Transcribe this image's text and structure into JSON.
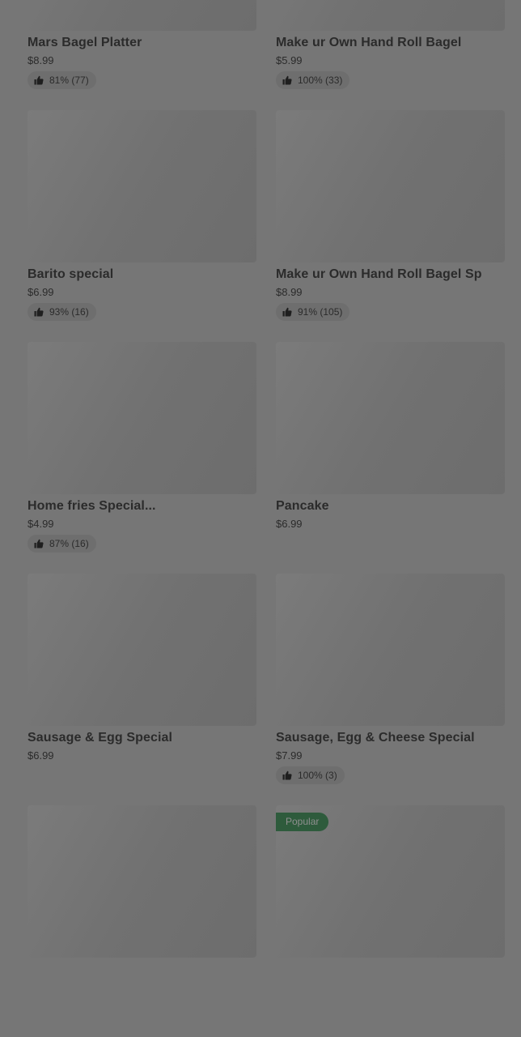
{
  "menu": {
    "items": [
      {
        "name": "Mars Bagel Platter",
        "price": "$8.99",
        "rating": "81% (77)",
        "badge": null
      },
      {
        "name": "Make ur Own Hand Roll Bagel",
        "price": "$5.99",
        "rating": "100% (33)",
        "badge": null
      },
      {
        "name": "Barito special",
        "price": "$6.99",
        "rating": "93% (16)",
        "badge": null
      },
      {
        "name": "Make ur Own Hand Roll Bagel Sp",
        "price": "$8.99",
        "rating": "91% (105)",
        "badge": null
      },
      {
        "name": "Home fries Special...",
        "price": "$4.99",
        "rating": "87% (16)",
        "badge": null
      },
      {
        "name": "Pancake",
        "price": "$6.99",
        "rating": null,
        "badge": null
      },
      {
        "name": "Sausage & Egg Special",
        "price": "$6.99",
        "rating": null,
        "badge": null
      },
      {
        "name": "Sausage, Egg & Cheese Special",
        "price": "$7.99",
        "rating": "100% (3)",
        "badge": null
      },
      {
        "name": "",
        "price": "",
        "rating": null,
        "badge": null
      },
      {
        "name": "",
        "price": "",
        "rating": null,
        "badge": "Popular"
      }
    ]
  },
  "icons": {
    "rating": "thumbs-up-icon"
  },
  "colors": {
    "badge_bg": "#2e5b3c",
    "overlay_bg": "#767676"
  }
}
